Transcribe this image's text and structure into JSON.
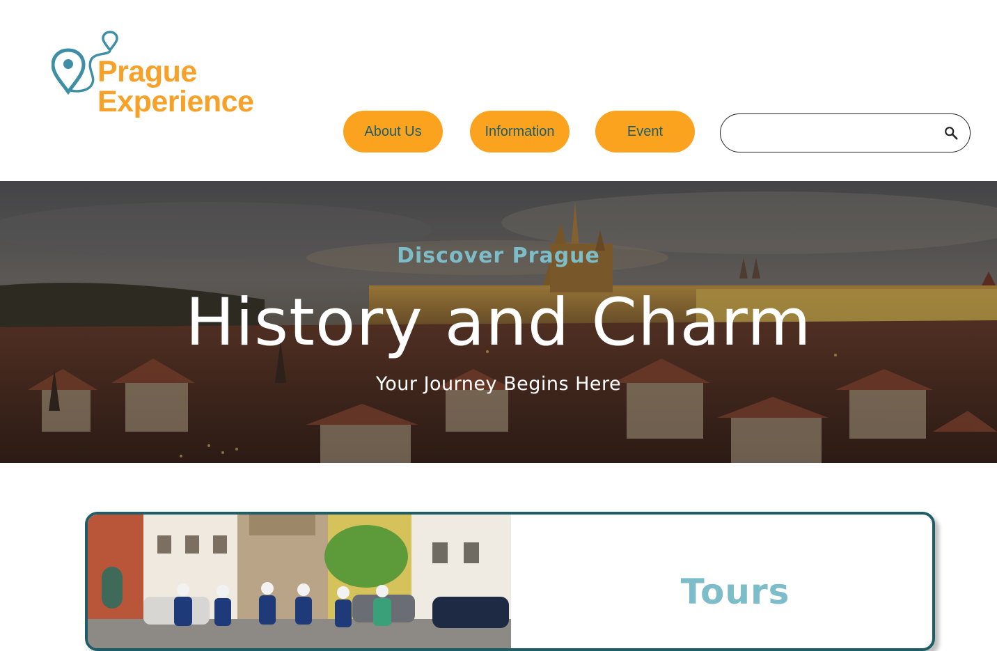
{
  "header": {
    "logo": {
      "line1": "Prague",
      "line2": "Experience"
    },
    "nav": [
      {
        "label": "About Us"
      },
      {
        "label": "Information"
      },
      {
        "label": "Event"
      }
    ],
    "search": {
      "placeholder": "",
      "value": "",
      "icon": "search-icon"
    }
  },
  "hero": {
    "kicker": "Discover Prague",
    "title": "History and Charm",
    "subtitle": "Your Journey Begins Here"
  },
  "card": {
    "title": "Tours"
  },
  "colors": {
    "brand_orange": "#f7a128",
    "button_bg": "#fba31f",
    "button_text": "#1d5d6a",
    "teal_accent": "#7dbcc9",
    "card_border": "#1c5d68"
  }
}
